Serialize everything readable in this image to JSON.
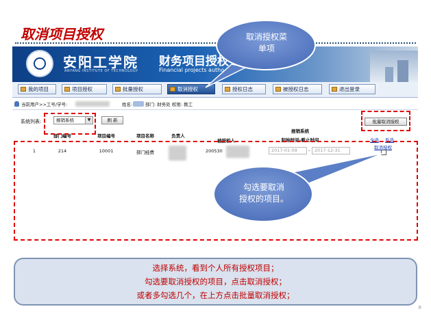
{
  "slide": {
    "title": "取消项目授权",
    "page_number": "8"
  },
  "header": {
    "school_name": "安阳工学院",
    "school_name_en": "ANYANG INSTITUTE OF TECHNOLOGY",
    "system_title": "财务项目授权",
    "system_subtitle": "Financial projects autho"
  },
  "nav": {
    "items": [
      {
        "label": "我的项目",
        "active": false
      },
      {
        "label": "项目授权",
        "active": false
      },
      {
        "label": "批量授权",
        "active": false
      },
      {
        "label": "取消授权",
        "active": true
      },
      {
        "label": "授权日志",
        "active": false
      },
      {
        "label": "被授权日志",
        "active": false
      },
      {
        "label": "退出登录",
        "active": false
      }
    ]
  },
  "userbar": {
    "label_user": "当前用户>>工号/学号:",
    "label_name": "姓名:",
    "label_dept": "部门: 财务处 权限: 教工"
  },
  "filter": {
    "system_label": "系统列表:",
    "system_value": "报销系统",
    "refresh_label": "刷  新",
    "batch_cancel_label": "批量取消授权"
  },
  "table": {
    "headers": {
      "dept_code": "部门编号",
      "project_code": "项目编号",
      "project_name": "项目名称",
      "owner": "负责人",
      "grantee": "被授权人",
      "system_group": "报销系统",
      "period": "起始时间-截止时间",
      "select_all": "全选",
      "invert": "反选"
    },
    "rows": [
      {
        "index": "1",
        "dept_code": "214",
        "project_code": "10001",
        "project_name": "部门经费",
        "grantee_id": "200530",
        "start_date": "2017-01-09",
        "end_date": "2017-12-31",
        "action": "取消授权"
      }
    ]
  },
  "callouts": {
    "top_line1": "取消授权菜",
    "top_line2": "单项",
    "mid_line1": "勾选要取消",
    "mid_line2": "授权的项目。"
  },
  "instructions": [
    "选择系统，看到个人所有授权项目；",
    "勾选要取消授权的项目，点击取消授权；",
    "或者多勾选几个，在上方点击批量取消授权；"
  ],
  "colors": {
    "accent_red": "#c00000",
    "header_blue": "#0d3f86",
    "callout_blue": "#5b7fc6",
    "highlight_dash": "#e00000"
  }
}
